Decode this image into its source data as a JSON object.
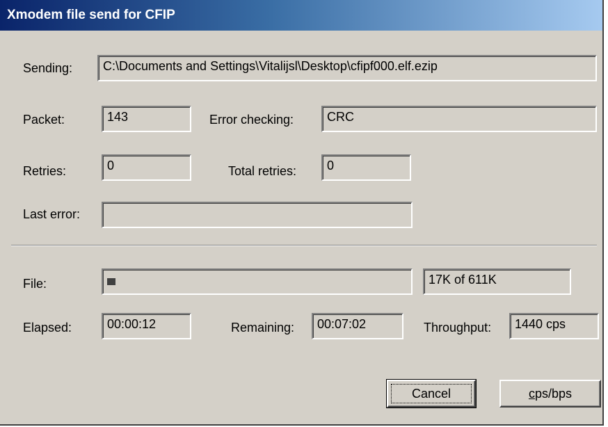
{
  "window": {
    "title": "Xmodem file send for CFIP"
  },
  "sending": {
    "label": "Sending:",
    "value": "C:\\Documents and Settings\\Vitalijsl\\Desktop\\cfipf000.elf.ezip"
  },
  "packet": {
    "label": "Packet:",
    "value": "143"
  },
  "error_checking": {
    "label": "Error checking:",
    "value": "CRC"
  },
  "retries": {
    "label": "Retries:",
    "value": "0"
  },
  "total_retries": {
    "label": "Total retries:",
    "value": "0"
  },
  "last_error": {
    "label": "Last error:",
    "value": ""
  },
  "file": {
    "label": "File:",
    "progress_fraction": 0.028,
    "status": "17K of 611K"
  },
  "elapsed": {
    "label": "Elapsed:",
    "value": "00:00:12"
  },
  "remaining": {
    "label": "Remaining:",
    "value": "00:07:02"
  },
  "throughput": {
    "label": "Throughput:",
    "value": "1440 cps"
  },
  "buttons": {
    "cancel_label": "Cancel",
    "cpsbps_first": "c",
    "cpsbps_rest": "ps/bps"
  },
  "colors": {
    "dialog_face": "#d4d0c8",
    "title_start": "#0a246a",
    "title_end": "#a6caf0",
    "title_text": "#ffffff"
  }
}
